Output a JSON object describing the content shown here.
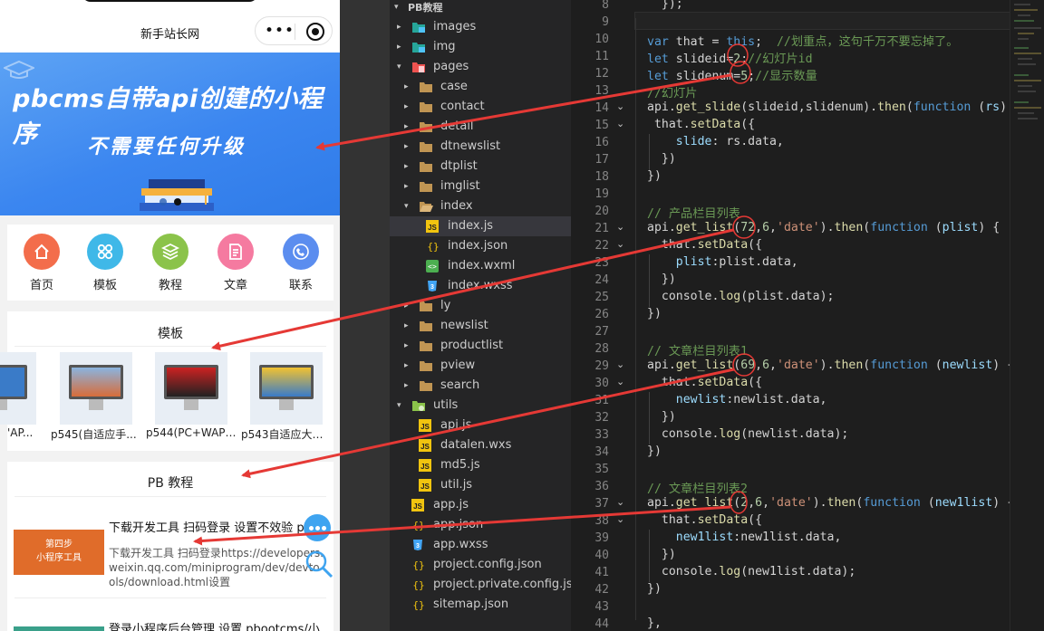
{
  "phone": {
    "title": "新手站长网",
    "capsule_dots": "•••",
    "banner": {
      "line1": "pbcms自带api创建的小程序",
      "line2": "不需要任何升级"
    },
    "nav": [
      {
        "label": "首页",
        "color": "#f36d4b"
      },
      {
        "label": "模板",
        "color": "#3fb8e8"
      },
      {
        "label": "教程",
        "color": "#8bc34a"
      },
      {
        "label": "文章",
        "color": "#f57aa0"
      },
      {
        "label": "联系",
        "color": "#5b8def"
      }
    ],
    "templates": {
      "heading": "模板",
      "items": [
        {
          "caption": "'AP..."
        },
        {
          "caption": "p545(自适应手..."
        },
        {
          "caption": "p544(PC+WAP)..."
        },
        {
          "caption": "p543自适应大气..."
        }
      ]
    },
    "tutorials": {
      "heading": "PB 教程",
      "items": [
        {
          "image_text_1": "第四步",
          "image_text_2": "小程序工具",
          "title": "下载开发工具 扫码登录 设置不效验 pboo",
          "desc": "下载开发工具 扫码登录https://developers.weixin.qq.com/miniprogram/dev/devtools/download.html设置"
        },
        {
          "title": "登录小程序后台管理 设置 pbootcms/小"
        }
      ]
    }
  },
  "explorer": {
    "header": "PB教程",
    "rows": [
      {
        "name": "images",
        "kind": "folder-img",
        "chev": "▸",
        "indent": 1
      },
      {
        "name": "img",
        "kind": "folder-img",
        "chev": "▸",
        "indent": 1
      },
      {
        "name": "pages",
        "kind": "folder-pages",
        "chev": "▾",
        "indent": 1
      },
      {
        "name": "case",
        "kind": "folder",
        "chev": "▸",
        "indent": 2
      },
      {
        "name": "contact",
        "kind": "folder",
        "chev": "▸",
        "indent": 2
      },
      {
        "name": "detail",
        "kind": "folder",
        "chev": "▸",
        "indent": 2
      },
      {
        "name": "dtnewslist",
        "kind": "folder",
        "chev": "▸",
        "indent": 2
      },
      {
        "name": "dtplist",
        "kind": "folder",
        "chev": "▸",
        "indent": 2
      },
      {
        "name": "imglist",
        "kind": "folder",
        "chev": "▸",
        "indent": 2
      },
      {
        "name": "index",
        "kind": "folder-open",
        "chev": "▾",
        "indent": 2
      },
      {
        "name": "index.js",
        "kind": "js",
        "chev": "",
        "indent": 3,
        "selected": true
      },
      {
        "name": "index.json",
        "kind": "json",
        "chev": "",
        "indent": 3
      },
      {
        "name": "index.wxml",
        "kind": "wxml",
        "chev": "",
        "indent": 3
      },
      {
        "name": "index.wxss",
        "kind": "wxss",
        "chev": "",
        "indent": 3
      },
      {
        "name": "ly",
        "kind": "folder",
        "chev": "▸",
        "indent": 2
      },
      {
        "name": "newslist",
        "kind": "folder",
        "chev": "▸",
        "indent": 2
      },
      {
        "name": "productlist",
        "kind": "folder",
        "chev": "▸",
        "indent": 2
      },
      {
        "name": "pview",
        "kind": "folder",
        "chev": "▸",
        "indent": 2
      },
      {
        "name": "search",
        "kind": "folder",
        "chev": "▸",
        "indent": 2
      },
      {
        "name": "utils",
        "kind": "folder-utils",
        "chev": "▾",
        "indent": 1
      },
      {
        "name": "api.js",
        "kind": "js",
        "chev": "",
        "indent": 2
      },
      {
        "name": "datalen.wxs",
        "kind": "js",
        "chev": "",
        "indent": 2
      },
      {
        "name": "md5.js",
        "kind": "js",
        "chev": "",
        "indent": 2
      },
      {
        "name": "util.js",
        "kind": "js",
        "chev": "",
        "indent": 2
      },
      {
        "name": "app.js",
        "kind": "js",
        "chev": "",
        "indent": 1
      },
      {
        "name": "app.json",
        "kind": "json",
        "chev": "",
        "indent": 1
      },
      {
        "name": "app.wxss",
        "kind": "wxss",
        "chev": "",
        "indent": 1
      },
      {
        "name": "project.config.json",
        "kind": "json",
        "chev": "",
        "indent": 1
      },
      {
        "name": "project.private.config.js...",
        "kind": "json",
        "chev": "",
        "indent": 1
      },
      {
        "name": "sitemap.json",
        "kind": "json",
        "chev": "",
        "indent": 1
      }
    ]
  },
  "editor": {
    "lines": [
      {
        "n": "8",
        "fold": "",
        "tokens": [
          [
            "pl",
            "  });"
          ]
        ]
      },
      {
        "n": "9",
        "fold": "",
        "tokens": []
      },
      {
        "n": "10",
        "fold": "",
        "tokens": [
          [
            "kw",
            "var"
          ],
          [
            "pl",
            " that = "
          ],
          [
            "kw",
            "this"
          ],
          [
            "pl",
            ";  "
          ],
          [
            "cm",
            "//划重点，这句千万不要忘掉了。"
          ]
        ]
      },
      {
        "n": "11",
        "fold": "",
        "tokens": [
          [
            "kw",
            "let"
          ],
          [
            "pl",
            " slideid="
          ],
          [
            "num",
            "2"
          ],
          [
            "pl",
            ";"
          ],
          [
            "cm",
            "//幻灯片id"
          ]
        ]
      },
      {
        "n": "12",
        "fold": "",
        "tokens": [
          [
            "kw",
            "let"
          ],
          [
            "pl",
            " slidenum="
          ],
          [
            "num",
            "5"
          ],
          [
            "pl",
            ";"
          ],
          [
            "cm",
            "//显示数量"
          ]
        ]
      },
      {
        "n": "13",
        "fold": "",
        "tokens": [
          [
            "cm",
            "//幻灯片"
          ]
        ]
      },
      {
        "n": "14",
        "fold": "⌄",
        "tokens": [
          [
            "pl",
            "api."
          ],
          [
            "fn",
            "get_slide"
          ],
          [
            "pl",
            "(slideid,slidenum)."
          ],
          [
            "fn",
            "then"
          ],
          [
            "pl",
            "("
          ],
          [
            "kw",
            "function"
          ],
          [
            "pl",
            " ("
          ],
          [
            "var",
            "rs"
          ],
          [
            "pl",
            ") {"
          ]
        ]
      },
      {
        "n": "15",
        "fold": "⌄",
        "tokens": [
          [
            "pl",
            " that."
          ],
          [
            "fn",
            "setData"
          ],
          [
            "pl",
            "({"
          ]
        ]
      },
      {
        "n": "16",
        "fold": "",
        "tokens": [
          [
            "pl",
            "    "
          ],
          [
            "var",
            "slide"
          ],
          [
            "pl",
            ": rs.data,"
          ]
        ]
      },
      {
        "n": "17",
        "fold": "",
        "tokens": [
          [
            "pl",
            "  })"
          ]
        ]
      },
      {
        "n": "18",
        "fold": "",
        "tokens": [
          [
            "pl",
            "})"
          ]
        ]
      },
      {
        "n": "19",
        "fold": "",
        "tokens": []
      },
      {
        "n": "20",
        "fold": "",
        "tokens": [
          [
            "cm",
            "// 产品栏目列表"
          ]
        ]
      },
      {
        "n": "21",
        "fold": "⌄",
        "tokens": [
          [
            "pl",
            "api."
          ],
          [
            "fn",
            "get_list"
          ],
          [
            "pl",
            "("
          ],
          [
            "num",
            "72"
          ],
          [
            "pl",
            ","
          ],
          [
            "num",
            "6"
          ],
          [
            "pl",
            ","
          ],
          [
            "str",
            "'date'"
          ],
          [
            "pl",
            ")."
          ],
          [
            "fn",
            "then"
          ],
          [
            "pl",
            "("
          ],
          [
            "kw",
            "function"
          ],
          [
            "pl",
            " ("
          ],
          [
            "var",
            "plist"
          ],
          [
            "pl",
            ") {"
          ]
        ]
      },
      {
        "n": "22",
        "fold": "⌄",
        "tokens": [
          [
            "pl",
            "  that."
          ],
          [
            "fn",
            "setData"
          ],
          [
            "pl",
            "({"
          ]
        ]
      },
      {
        "n": "23",
        "fold": "",
        "tokens": [
          [
            "pl",
            "    "
          ],
          [
            "var",
            "plist"
          ],
          [
            "pl",
            ":plist.data,"
          ]
        ]
      },
      {
        "n": "24",
        "fold": "",
        "tokens": [
          [
            "pl",
            "  })"
          ]
        ]
      },
      {
        "n": "25",
        "fold": "",
        "tokens": [
          [
            "pl",
            "  console."
          ],
          [
            "fn",
            "log"
          ],
          [
            "pl",
            "(plist.data);"
          ]
        ]
      },
      {
        "n": "26",
        "fold": "",
        "tokens": [
          [
            "pl",
            "})"
          ]
        ]
      },
      {
        "n": "27",
        "fold": "",
        "tokens": []
      },
      {
        "n": "28",
        "fold": "",
        "tokens": [
          [
            "cm",
            "// 文章栏目列表1"
          ]
        ]
      },
      {
        "n": "29",
        "fold": "⌄",
        "tokens": [
          [
            "pl",
            "api."
          ],
          [
            "fn",
            "get_list"
          ],
          [
            "pl",
            "("
          ],
          [
            "num",
            "69"
          ],
          [
            "pl",
            ","
          ],
          [
            "num",
            "6"
          ],
          [
            "pl",
            ","
          ],
          [
            "str",
            "'date'"
          ],
          [
            "pl",
            ")."
          ],
          [
            "fn",
            "then"
          ],
          [
            "pl",
            "("
          ],
          [
            "kw",
            "function"
          ],
          [
            "pl",
            " ("
          ],
          [
            "var",
            "newlist"
          ],
          [
            "pl",
            ") {"
          ]
        ]
      },
      {
        "n": "30",
        "fold": "⌄",
        "tokens": [
          [
            "pl",
            "  that."
          ],
          [
            "fn",
            "setData"
          ],
          [
            "pl",
            "({"
          ]
        ]
      },
      {
        "n": "31",
        "fold": "",
        "tokens": [
          [
            "pl",
            "    "
          ],
          [
            "var",
            "newlist"
          ],
          [
            "pl",
            ":newlist.data,"
          ]
        ]
      },
      {
        "n": "32",
        "fold": "",
        "tokens": [
          [
            "pl",
            "  })"
          ]
        ]
      },
      {
        "n": "33",
        "fold": "",
        "tokens": [
          [
            "pl",
            "  console."
          ],
          [
            "fn",
            "log"
          ],
          [
            "pl",
            "(newlist.data);"
          ]
        ]
      },
      {
        "n": "34",
        "fold": "",
        "tokens": [
          [
            "pl",
            "})"
          ]
        ]
      },
      {
        "n": "35",
        "fold": "",
        "tokens": []
      },
      {
        "n": "36",
        "fold": "",
        "tokens": [
          [
            "cm",
            "// 文章栏目列表2"
          ]
        ]
      },
      {
        "n": "37",
        "fold": "⌄",
        "tokens": [
          [
            "pl",
            "api."
          ],
          [
            "fn",
            "get_list"
          ],
          [
            "pl",
            "("
          ],
          [
            "num",
            "2"
          ],
          [
            "pl",
            ","
          ],
          [
            "num",
            "6"
          ],
          [
            "pl",
            ","
          ],
          [
            "str",
            "'date'"
          ],
          [
            "pl",
            ")."
          ],
          [
            "fn",
            "then"
          ],
          [
            "pl",
            "("
          ],
          [
            "kw",
            "function"
          ],
          [
            "pl",
            " ("
          ],
          [
            "var",
            "new1list"
          ],
          [
            "pl",
            ") {"
          ]
        ]
      },
      {
        "n": "38",
        "fold": "⌄",
        "tokens": [
          [
            "pl",
            "  that."
          ],
          [
            "fn",
            "setData"
          ],
          [
            "pl",
            "({"
          ]
        ]
      },
      {
        "n": "39",
        "fold": "",
        "tokens": [
          [
            "pl",
            "    "
          ],
          [
            "var",
            "new1list"
          ],
          [
            "pl",
            ":new1list.data,"
          ]
        ]
      },
      {
        "n": "40",
        "fold": "",
        "tokens": [
          [
            "pl",
            "  })"
          ]
        ]
      },
      {
        "n": "41",
        "fold": "",
        "tokens": [
          [
            "pl",
            "  console."
          ],
          [
            "fn",
            "log"
          ],
          [
            "pl",
            "(new1list.data);"
          ]
        ]
      },
      {
        "n": "42",
        "fold": "",
        "tokens": [
          [
            "pl",
            "})"
          ]
        ]
      },
      {
        "n": "43",
        "fold": "",
        "tokens": []
      },
      {
        "n": "44",
        "fold": "",
        "tokens": [
          [
            "pl",
            "},"
          ]
        ]
      }
    ]
  },
  "colors": {
    "banner_blue": "#3b86f0",
    "arrow_red": "#e53935",
    "editor_bg": "#1e1e1e",
    "sidebar_bg": "#252526"
  }
}
